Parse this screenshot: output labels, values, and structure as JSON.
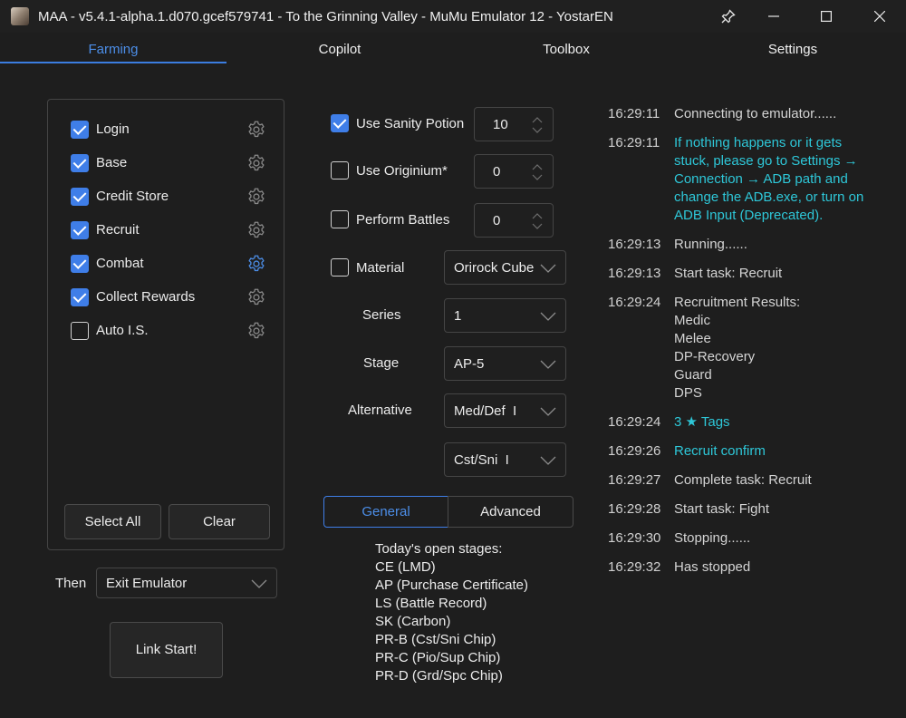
{
  "window": {
    "title": "MAA - v5.4.1-alpha.1.d070.gcef579741 - To the Grinning Valley - MuMu Emulator 12 - YostarEN",
    "icons": [
      "app-icon",
      "pin-icon",
      "minimize-icon",
      "maximize-icon",
      "close-icon"
    ]
  },
  "tabs": [
    {
      "label": "Farming",
      "active": true
    },
    {
      "label": "Copilot",
      "active": false
    },
    {
      "label": "Toolbox",
      "active": false
    },
    {
      "label": "Settings",
      "active": false
    }
  ],
  "tasks": [
    {
      "label": "Login",
      "checked": true,
      "gear_active": false
    },
    {
      "label": "Base",
      "checked": true,
      "gear_active": false
    },
    {
      "label": "Credit Store",
      "checked": true,
      "gear_active": false
    },
    {
      "label": "Recruit",
      "checked": true,
      "gear_active": false
    },
    {
      "label": "Combat",
      "checked": true,
      "gear_active": true
    },
    {
      "label": "Collect Rewards",
      "checked": true,
      "gear_active": false
    },
    {
      "label": "Auto I.S.",
      "checked": false,
      "gear_active": false
    }
  ],
  "task_buttons": {
    "select_all": "Select All",
    "clear": "Clear"
  },
  "then": {
    "label": "Then",
    "value": "Exit Emulator"
  },
  "link_start": "Link Start!",
  "options": {
    "sanity": {
      "label": "Use Sanity Potion",
      "checked": true,
      "value": "10"
    },
    "originium": {
      "label": "Use Originium*",
      "checked": false,
      "value": "0"
    },
    "battles": {
      "label": "Perform Battles",
      "checked": false,
      "value": "0"
    },
    "material": {
      "label": "Material",
      "checked": false,
      "value": "Orirock Cube"
    },
    "series": {
      "label": "Series",
      "value": "1"
    },
    "stage": {
      "label": "Stage",
      "value": "AP-5"
    },
    "alternative": {
      "label": "Alternative",
      "value": "Med/Def  I"
    },
    "alternative2": {
      "value": "Cst/Sni  I"
    }
  },
  "segment": {
    "general": "General",
    "advanced": "Advanced",
    "active": "general"
  },
  "stages": {
    "heading": "Today's open stages:",
    "items": [
      "CE (LMD)",
      "AP (Purchase Certificate)",
      "LS (Battle Record)",
      "SK (Carbon)",
      "PR-B (Cst/Sni Chip)",
      "PR-C (Pio/Sup Chip)",
      "PR-D (Grd/Spc Chip)"
    ]
  },
  "log": [
    {
      "time": "16:29:11",
      "message": "Connecting to emulator......",
      "color": "#d4d4d4"
    },
    {
      "time": "16:29:11",
      "message": "If nothing happens or it gets stuck, please go to Settings → Connection → ADB path and change the ADB.exe, or turn on ADB Input (Deprecated).",
      "color": "#2ec7d8"
    },
    {
      "time": "16:29:13",
      "message": "Running......",
      "color": "#d4d4d4"
    },
    {
      "time": "16:29:13",
      "message": "Start task: Recruit",
      "color": "#d4d4d4"
    },
    {
      "time": "16:29:24",
      "message": "Recruitment Results:\nMedic\nMelee\nDP-Recovery\nGuard\nDPS",
      "color": "#d4d4d4"
    },
    {
      "time": "16:29:24",
      "message": "3 ★ Tags",
      "color": "#2ec7d8"
    },
    {
      "time": "16:29:26",
      "message": "Recruit confirm",
      "color": "#2ec7d8"
    },
    {
      "time": "16:29:27",
      "message": "Complete task: Recruit",
      "color": "#d4d4d4"
    },
    {
      "time": "16:29:28",
      "message": "Start task: Fight",
      "color": "#d4d4d4"
    },
    {
      "time": "16:29:30",
      "message": "Stopping......",
      "color": "#d4d4d4"
    },
    {
      "time": "16:29:32",
      "message": "Has stopped",
      "color": "#d4d4d4"
    }
  ],
  "colors": {
    "accent": "#3f7ee8",
    "log_highlight": "#2ec7d8",
    "background": "#1e1e1e"
  }
}
